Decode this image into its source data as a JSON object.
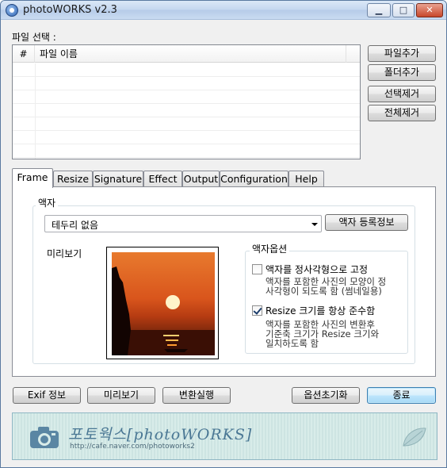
{
  "window": {
    "title": "photoWORKS v2.3",
    "minimize": "▁",
    "maximize": "□",
    "close": "✕"
  },
  "file_section": {
    "label": "파일 선택 :",
    "columns": [
      "#",
      "파일 이름"
    ],
    "buttons": [
      "파일추가",
      "폴더추가",
      "선택제거",
      "전체제거"
    ]
  },
  "tabs": [
    "Frame",
    "Resize",
    "Signature",
    "Effect",
    "Output",
    "Configuration",
    "Help"
  ],
  "active_tab": "Frame",
  "frame": {
    "group_label": "액자",
    "frame_select_value": "테두리 없음",
    "register_button": "액자 등록정보",
    "preview_label": "미리보기",
    "options_label": "액자옵션",
    "option1": {
      "label": "액자를 정사각형으로 고정",
      "checked": false,
      "desc": [
        "액자를 포함한 사진의 모양이 정",
        "사각형이 되도록 함 (썸네일용)"
      ]
    },
    "option2": {
      "label": "Resize 크기를 항상 준수함",
      "checked": true,
      "desc": [
        "액자를 포함한 사진의 변환후",
        "기준축 크기가 Resize 크기와",
        "일치하도록 함"
      ]
    }
  },
  "bottom_buttons": {
    "exif": "Exif 정보",
    "preview": "미리보기",
    "convert": "변환실행",
    "reset_options": "옵션초기화",
    "exit": "종료"
  },
  "banner": {
    "title": "포토웍스[photoWORKS]",
    "url": "http://cafe.naver.com/photoworks2"
  },
  "colors": {
    "title_bar": "#c4d7ef",
    "close_button": "#c8472b",
    "default_button": "#bee6fd",
    "banner_bg": "#d8ece9",
    "banner_text": "#4a7794"
  },
  "icons": [
    "app-camera-icon",
    "minimize-icon",
    "maximize-icon",
    "close-icon",
    "dropdown-arrow-icon",
    "camera-icon",
    "leaf-icon"
  ]
}
